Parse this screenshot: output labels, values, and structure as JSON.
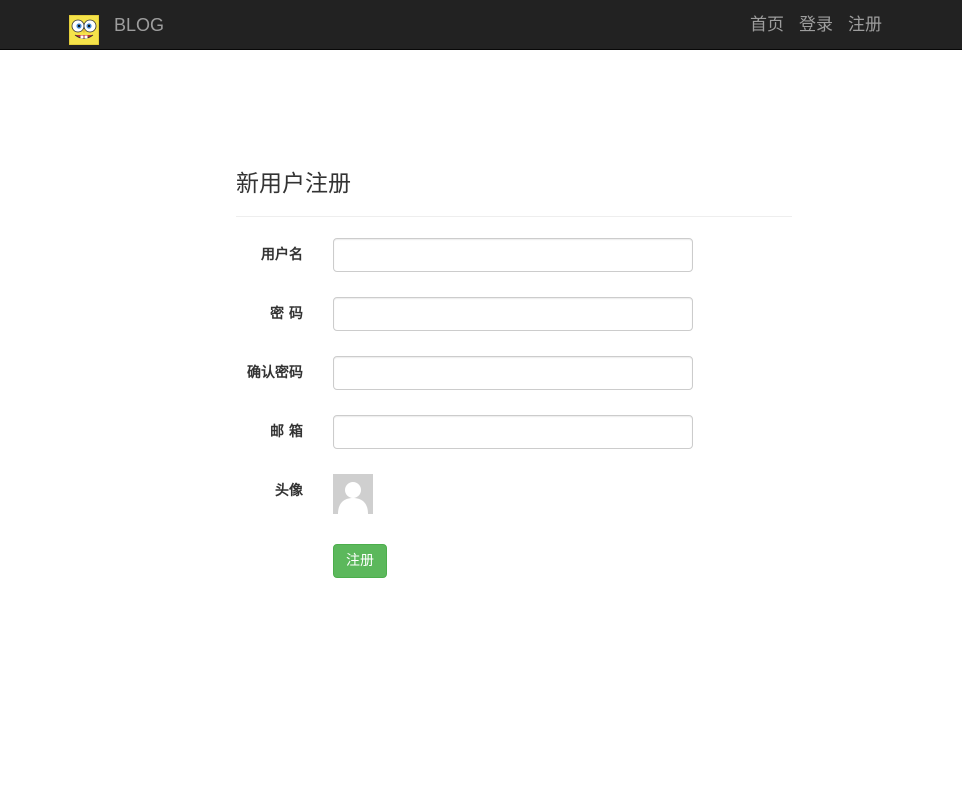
{
  "navbar": {
    "brand": "BLOG",
    "links": [
      "首页",
      "登录",
      "注册"
    ]
  },
  "form": {
    "title": "新用户注册",
    "fields": [
      {
        "label": "用户名",
        "value": "",
        "placeholder": ""
      },
      {
        "label": "密 码",
        "value": "",
        "placeholder": ""
      },
      {
        "label": "确认密码",
        "value": "",
        "placeholder": ""
      },
      {
        "label": "邮 箱",
        "value": "",
        "placeholder": ""
      }
    ],
    "avatar_label": "头像",
    "submit_label": "注册"
  },
  "colors": {
    "navbar_bg": "#222222",
    "nav_text": "#9d9d9d",
    "button_green": "#5cb85c",
    "avatar_gray": "#cfcfcf"
  }
}
